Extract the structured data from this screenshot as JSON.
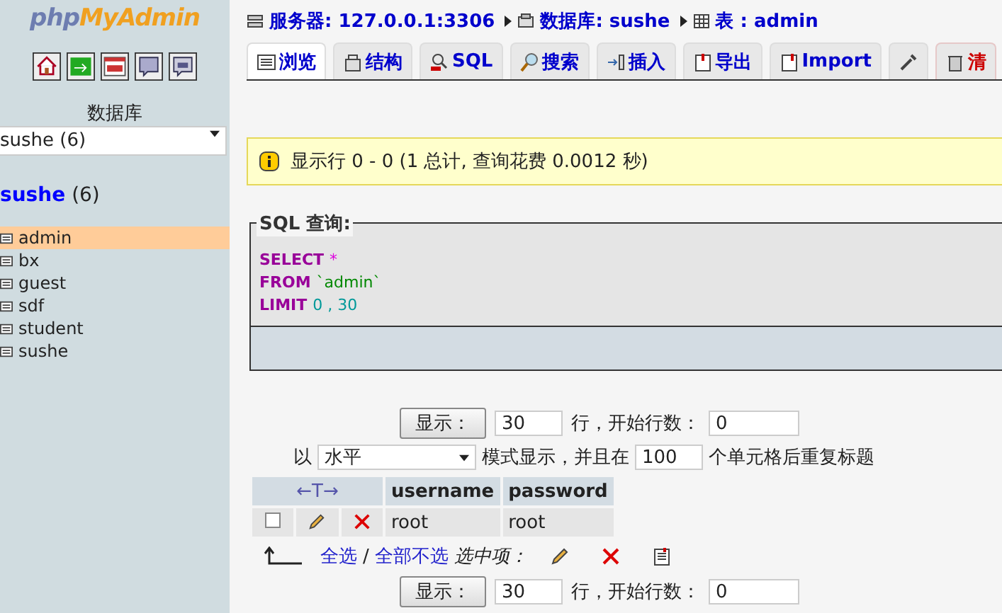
{
  "sidebar": {
    "logo": {
      "part_1": "php",
      "part_2": "MyAdmin"
    },
    "db_label": "数据库",
    "db_select": {
      "value": "sushe (6)"
    },
    "db_heading": {
      "name": "sushe",
      "count": "(6)"
    },
    "tables": [
      {
        "name": "admin",
        "selected": true
      },
      {
        "name": "bx",
        "selected": false
      },
      {
        "name": "guest",
        "selected": false
      },
      {
        "name": "sdf",
        "selected": false
      },
      {
        "name": "student",
        "selected": false
      },
      {
        "name": "sushe",
        "selected": false
      }
    ]
  },
  "breadcrumb": [
    {
      "kind": "server",
      "text": "服务器: 127.0.0.1:3306"
    },
    {
      "kind": "database",
      "text": "数据库: sushe"
    },
    {
      "kind": "table",
      "text": "表 : admin"
    }
  ],
  "tabs": [
    {
      "label": "浏览",
      "selected": true,
      "danger": false
    },
    {
      "label": "结构",
      "selected": false,
      "danger": false
    },
    {
      "label": "SQL",
      "selected": false,
      "danger": false
    },
    {
      "label": "搜索",
      "selected": false,
      "danger": false
    },
    {
      "label": "插入",
      "selected": false,
      "danger": false
    },
    {
      "label": "导出",
      "selected": false,
      "danger": false
    },
    {
      "label": "Import",
      "selected": false,
      "danger": false
    },
    {
      "selected": false,
      "danger": false
    },
    {
      "label": "清",
      "selected": false,
      "danger": true
    }
  ],
  "notice": {
    "text": "显示行 0 - 0 (1 总计, 查询花费 0.0012 秒)"
  },
  "sql_box": {
    "legend": "SQL 查询:",
    "lines": [
      [
        {
          "kind": "keyword",
          "text": "SELECT"
        },
        {
          "kind": "operator",
          "text": "*"
        }
      ],
      [
        {
          "kind": "keyword",
          "text": "FROM"
        },
        {
          "kind": "string",
          "text": "`admin`"
        }
      ],
      [
        {
          "kind": "keyword",
          "text": "LIMIT"
        },
        {
          "kind": "number",
          "text": "0 , 30"
        }
      ]
    ]
  },
  "nav_top": {
    "button": "显示：",
    "rows_value": "30",
    "rows_label": "行，开始行数：",
    "start_value": "0"
  },
  "display_row": {
    "prefix": "以",
    "mode_value": "水平",
    "middle": "模式显示，并且在",
    "repeat_value": "100",
    "suffix": "个单元格后重复标题"
  },
  "results": {
    "header_arrows": "←T→",
    "columns": [
      "username",
      "password"
    ],
    "rows": [
      {
        "checked": false,
        "cells": [
          "root",
          "root"
        ]
      }
    ]
  },
  "bulk": {
    "check_all": "全选",
    "separator": "/",
    "uncheck_all": "全部不选",
    "with_selected": "选中项："
  },
  "nav_bottom": {
    "button": "显示：",
    "rows_value": "30",
    "rows_label": "行，开始行数：",
    "start_value": "0"
  }
}
